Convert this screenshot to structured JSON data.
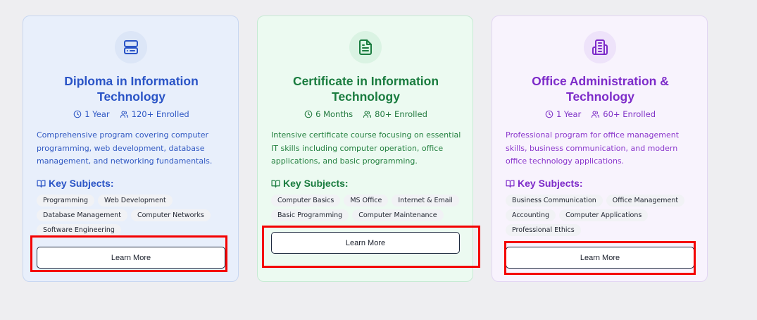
{
  "programs": [
    {
      "title": "Diploma in Information Technology",
      "duration": "1 Year",
      "enrolled": "120+ Enrolled",
      "description": "Comprehensive program covering computer programming, web development, database management, and networking fundamentals.",
      "subjects_heading": "Key Subjects:",
      "subjects": [
        "Programming",
        "Web Development",
        "Database Management",
        "Computer Networks",
        "Software Engineering"
      ],
      "button": "Learn More",
      "icon": "server-icon",
      "accent": "#2a54c6"
    },
    {
      "title": "Certificate in Information Technology",
      "duration": "6 Months",
      "enrolled": "80+ Enrolled",
      "description": "Intensive certificate course focusing on essential IT skills including computer operation, office applications, and basic programming.",
      "subjects_heading": "Key Subjects:",
      "subjects": [
        "Computer Basics",
        "MS Office",
        "Internet & Email",
        "Basic Programming",
        "Computer Maintenance"
      ],
      "button": "Learn More",
      "icon": "document-icon",
      "accent": "#1a7c3f"
    },
    {
      "title": "Office Administration & Technology",
      "duration": "1 Year",
      "enrolled": "60+ Enrolled",
      "description": "Professional program for office management skills, business communication, and modern office technology applications.",
      "subjects_heading": "Key Subjects:",
      "subjects": [
        "Business Communication",
        "Office Management",
        "Accounting",
        "Computer Applications",
        "Professional Ethics"
      ],
      "button": "Learn More",
      "icon": "building-icon",
      "accent": "#7d2bc9"
    }
  ],
  "highlight_color": "#f40000"
}
